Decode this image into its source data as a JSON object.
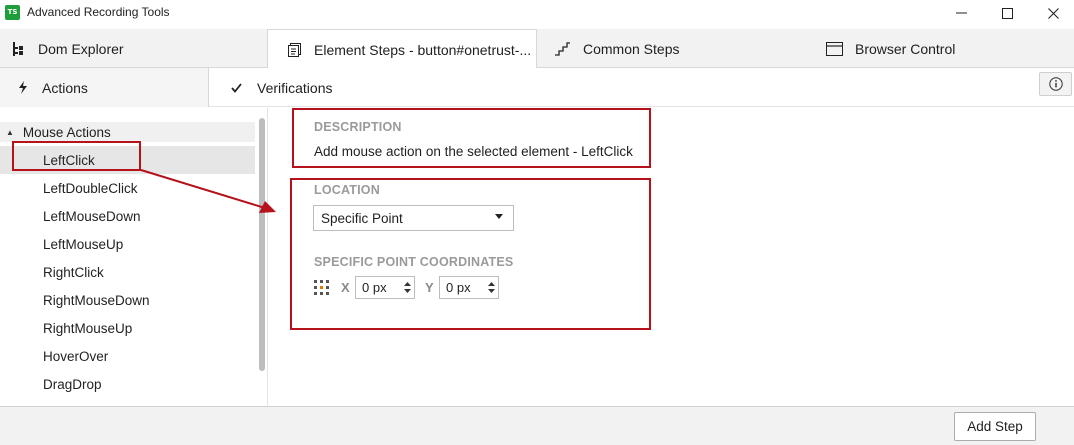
{
  "window": {
    "logo_text": "TS",
    "title": "Advanced Recording Tools"
  },
  "top_tabs": [
    {
      "label": "Dom Explorer",
      "icon": "dom-explorer-icon"
    },
    {
      "label": "Element Steps - button#onetrust-...",
      "icon": "element-steps-icon"
    },
    {
      "label": "Common Steps",
      "icon": "stairs-icon"
    },
    {
      "label": "Browser Control",
      "icon": "browser-window-icon"
    }
  ],
  "sub_tabs": [
    {
      "label": "Actions",
      "icon": "lightning-icon"
    },
    {
      "label": "Verifications",
      "icon": "checkmark-icon"
    }
  ],
  "actions_list": {
    "group": "Mouse Actions",
    "items": [
      "LeftClick",
      "LeftDoubleClick",
      "LeftMouseDown",
      "LeftMouseUp",
      "RightClick",
      "RightMouseDown",
      "RightMouseUp",
      "HoverOver",
      "DragDrop"
    ],
    "selected": "LeftClick"
  },
  "description": {
    "heading": "DESCRIPTION",
    "text": "Add mouse action on the selected element - LeftClick"
  },
  "location": {
    "heading": "LOCATION",
    "selected_option": "Specific Point",
    "coords_heading": "SPECIFIC POINT COORDINATES",
    "x_label": "X",
    "x_value": "0 px",
    "y_label": "Y",
    "y_value": "0 px"
  },
  "footer": {
    "add_step_label": "Add Step"
  },
  "colors": {
    "highlight_red": "#b5121b",
    "logo_green": "#1f9e3b"
  }
}
